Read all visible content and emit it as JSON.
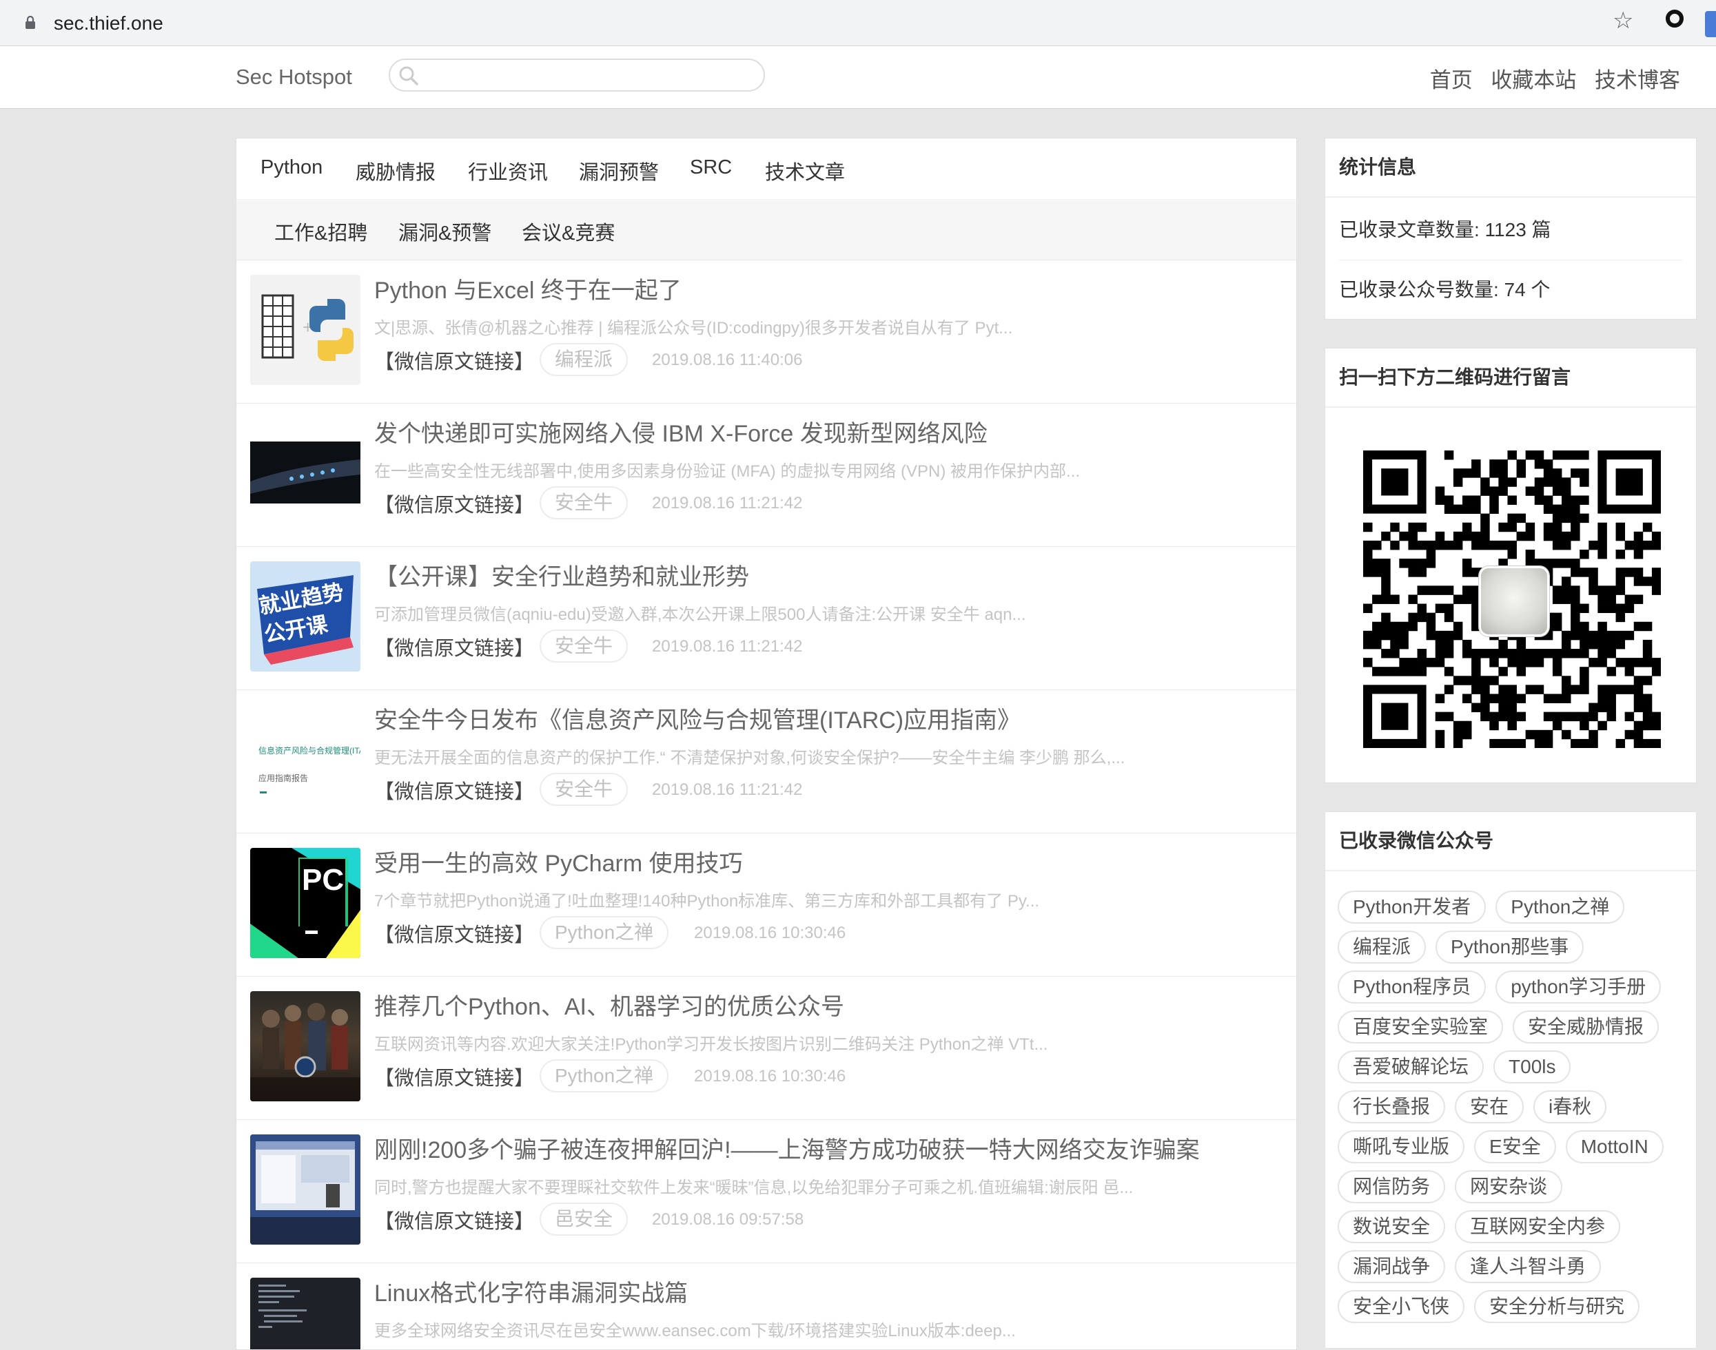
{
  "browser": {
    "url": "sec.thief.one"
  },
  "site": {
    "brand": "Sec Hotspot",
    "search_placeholder": "",
    "nav": [
      "首页",
      "收藏本站",
      "技术博客"
    ]
  },
  "tabs_row1": [
    "Python",
    "威胁情报",
    "行业资讯",
    "漏洞预警",
    "SRC",
    "技术文章"
  ],
  "tabs_row2": [
    "工作&招聘",
    "漏洞&预警",
    "会议&竞赛"
  ],
  "link_label": "【微信原文链接】",
  "articles": [
    {
      "title": "Python 与Excel 终于在一起了",
      "summary": "文|思源、张倩@机器之心推荐 | 编程派公众号(ID:codingpy)很多开发者说自从有了 Pyt...",
      "source": "编程派",
      "date": "2019.08.16 11:40:06",
      "thumb": "excel-python-thumbnail"
    },
    {
      "title": "发个快递即可实施网络入侵 IBM X-Force 发现新型网络风险",
      "summary": "在一些高安全性无线部署中,使用多因素身份验证 (MFA) 的虚拟专用网络 (VPN) 被用作保护内部...",
      "source": "安全牛",
      "date": "2019.08.16 11:21:42",
      "thumb": "router-device-thumbnail"
    },
    {
      "title": "【公开课】安全行业趋势和就业形势",
      "summary": "可添加管理员微信(aqniu-edu)受邀入群,本次公开课上限500人请备注:公开课 安全牛 aqn...",
      "source": "安全牛",
      "date": "2019.08.16 11:21:42",
      "thumb": "course-banner-thumbnail",
      "thumb_text": [
        "就业趋势",
        "公开课"
      ]
    },
    {
      "title": "安全牛今日发布《信息资产风险与合规管理(ITARC)应用指南》",
      "summary": "更无法开展全面的信息资产的保护工作.“ 不清楚保护对象,何谈安全保护?——安全牛主编 李少鹏 那么,...",
      "source": "安全牛",
      "date": "2019.08.16 11:21:42",
      "thumb": "report-cover-thumbnail",
      "thumb_text": [
        "信息资产风险与合规管理(ITARC)",
        "应用指南报告"
      ]
    },
    {
      "title": "受用一生的高效 PyCharm 使用技巧",
      "summary": "7个章节就把Python说通了!吐血整理!140种Python标准库、第三方库和外部工具都有了 Py...",
      "source": "Python之禅",
      "date": "2019.08.16 10:30:46",
      "thumb": "pycharm-logo-thumbnail",
      "thumb_text": [
        "PC"
      ]
    },
    {
      "title": "推荐几个Python、AI、机器学习的优质公众号",
      "summary": "互联网资讯等内容.欢迎大家关注!Python学习开发长按图片识别二维码关注 Python之禅 VTt...",
      "source": "Python之禅",
      "date": "2019.08.16 10:30:46",
      "thumb": "movie-poster-thumbnail"
    },
    {
      "title": "刚刚!200多个骗子被连夜押解回沪!——上海警方成功破获一特大网络交友诈骗案",
      "summary": "同时,警方也提醒大家不要理睬社交软件上发来“暖昧”信息,以免给犯罪分子可乘之机.值班编辑:谢辰阳 邑...",
      "source": "邑安全",
      "date": "2019.08.16 09:57:58",
      "thumb": "screen-photo-thumbnail"
    },
    {
      "title": "Linux格式化字符串漏洞实战篇",
      "summary": "更多全球网络安全资讯尽在邑安全www.eansec.com下载/环境搭建实验Linux版本:deep...",
      "source": "",
      "date": "",
      "thumb": "code-editor-thumbnail"
    }
  ],
  "sidebar": {
    "stats_title": "统计信息",
    "stats": [
      "已收录文章数量: 1123 篇",
      "已收录公众号数量: 74 个"
    ],
    "qr_title": "扫一扫下方二维码进行留言",
    "accounts_title": "已收录微信公众号",
    "accounts": [
      "Python开发者",
      "Python之禅",
      "编程派",
      "Python那些事",
      "Python程序员",
      "python学习手册",
      "百度安全实验室",
      "安全威胁情报",
      "吾爱破解论坛",
      "T00ls",
      "行长叠报",
      "安在",
      "i春秋",
      "嘶吼专业版",
      "E安全",
      "MottoIN",
      "网信防务",
      "网安杂谈",
      "数说安全",
      "互联网安全内参",
      "漏洞战争",
      "逢人斗智斗勇",
      "安全小飞侠",
      "安全分析与研究"
    ]
  }
}
